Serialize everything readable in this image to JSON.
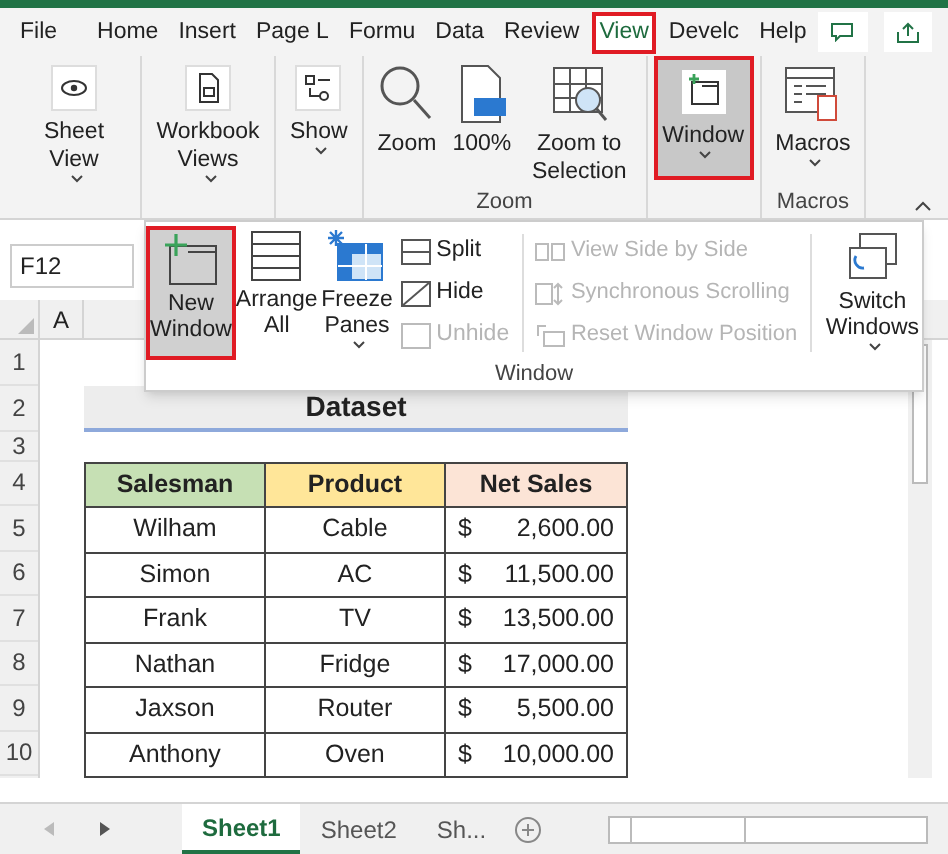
{
  "tabs": [
    {
      "label": "File",
      "selected": false,
      "highlighted": false
    },
    {
      "label": "Home",
      "selected": false,
      "highlighted": false
    },
    {
      "label": "Insert",
      "selected": false,
      "highlighted": false
    },
    {
      "label": "Page L",
      "selected": false,
      "highlighted": false
    },
    {
      "label": "Formu",
      "selected": false,
      "highlighted": false
    },
    {
      "label": "Data",
      "selected": false,
      "highlighted": false
    },
    {
      "label": "Review",
      "selected": false,
      "highlighted": false
    },
    {
      "label": "View",
      "selected": true,
      "highlighted": true
    },
    {
      "label": "Develc",
      "selected": false,
      "highlighted": false
    },
    {
      "label": "Help",
      "selected": false,
      "highlighted": false
    }
  ],
  "ribbon_groups": [
    {
      "buttons": [
        {
          "kind": "eye",
          "label": "Sheet View",
          "dropdown": true,
          "pressed": false,
          "highlighted": false
        }
      ]
    },
    {
      "buttons": [
        {
          "kind": "book",
          "label": "Workbook Views",
          "dropdown": true,
          "pressed": false,
          "highlighted": false
        }
      ]
    },
    {
      "buttons": [
        {
          "kind": "show",
          "label": "Show",
          "dropdown": true,
          "pressed": false,
          "highlighted": false
        }
      ]
    },
    {
      "label": "Zoom",
      "buttons": [
        {
          "kind": "zoom",
          "label": "Zoom",
          "dropdown": false,
          "pressed": false,
          "highlighted": false
        },
        {
          "kind": "hundred",
          "label": "100%",
          "dropdown": false,
          "pressed": false,
          "highlighted": false
        },
        {
          "kind": "selection",
          "label": "Zoom to Selection",
          "dropdown": false,
          "pressed": false,
          "highlighted": false
        }
      ]
    },
    {
      "buttons": [
        {
          "kind": "window",
          "label": "Window",
          "dropdown": true,
          "pressed": true,
          "highlighted": true
        }
      ]
    },
    {
      "label": "Macros",
      "buttons": [
        {
          "kind": "macros",
          "label": "Macros",
          "dropdown": true,
          "pressed": false,
          "highlighted": false
        }
      ]
    }
  ],
  "window_menu": {
    "label": "Window",
    "large_buttons": [
      {
        "kind": "new",
        "label": "New Window",
        "dropdown": false,
        "highlighted": true
      },
      {
        "kind": "arrange",
        "label": "Arrange All",
        "dropdown": false,
        "highlighted": false
      },
      {
        "kind": "freeze",
        "label": "Freeze Panes",
        "dropdown": true,
        "highlighted": false
      }
    ],
    "small_buttons": [
      {
        "label": "Split",
        "disabled": false
      },
      {
        "label": "Hide",
        "disabled": false
      },
      {
        "label": "Unhide",
        "disabled": true
      }
    ],
    "side_buttons": [
      {
        "label": "View Side by Side",
        "disabled": true
      },
      {
        "label": "Synchronous Scrolling",
        "disabled": true
      },
      {
        "label": "Reset Window Position",
        "disabled": true
      }
    ],
    "switch_button": {
      "label": "Switch Windows",
      "dropdown": true
    }
  },
  "name_box": "F12",
  "columns": [
    "A"
  ],
  "row_numbers": [
    "1",
    "2",
    "3",
    "4",
    "5",
    "6",
    "7",
    "8",
    "9",
    "10"
  ],
  "dataset_title": "Dataset",
  "table": {
    "columns": [
      {
        "label": "Salesman",
        "color": "#c6e0b4"
      },
      {
        "label": "Product",
        "color": "#ffe699"
      },
      {
        "label": "Net Sales",
        "color": "#fce4d6"
      }
    ],
    "rows": [
      {
        "salesman": "Wilham",
        "product": "Cable",
        "currency": "$",
        "amount": "2,600.00"
      },
      {
        "salesman": "Simon",
        "product": "AC",
        "currency": "$",
        "amount": "11,500.00"
      },
      {
        "salesman": "Frank",
        "product": "TV",
        "currency": "$",
        "amount": "13,500.00"
      },
      {
        "salesman": "Nathan",
        "product": "Fridge",
        "currency": "$",
        "amount": "17,000.00"
      },
      {
        "salesman": "Jaxson",
        "product": "Router",
        "currency": "$",
        "amount": "5,500.00"
      },
      {
        "salesman": "Anthony",
        "product": "Oven",
        "currency": "$",
        "amount": "10,000.00"
      }
    ]
  },
  "sheet_tabs": [
    {
      "label": "Sheet1",
      "selected": true
    },
    {
      "label": "Sheet2",
      "selected": false
    },
    {
      "label": "Sh...",
      "selected": false
    }
  ]
}
